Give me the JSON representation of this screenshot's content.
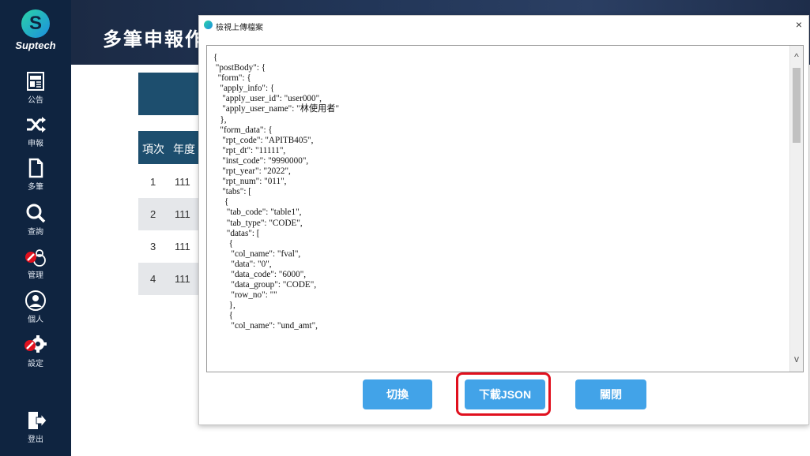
{
  "sidebar": {
    "brand": "Suptech",
    "items": [
      {
        "label": "公告",
        "icon": "announcement-icon"
      },
      {
        "label": "申報",
        "icon": "shuffle-icon"
      },
      {
        "label": "多筆",
        "icon": "document-icon"
      },
      {
        "label": "查詢",
        "icon": "search-icon"
      },
      {
        "label": "管理",
        "icon": "users-admin-icon"
      },
      {
        "label": "個人",
        "icon": "user-icon"
      },
      {
        "label": "設定",
        "icon": "gear-icon"
      },
      {
        "label": "登出",
        "icon": "logout-icon"
      }
    ]
  },
  "header": {
    "title": "多筆申報作"
  },
  "table": {
    "headers": [
      "項次",
      "年度"
    ],
    "rows": [
      [
        "1",
        "111"
      ],
      [
        "2",
        "111"
      ],
      [
        "3",
        "111"
      ],
      [
        "4",
        "111"
      ]
    ]
  },
  "modal": {
    "title": "檢視上傳檔案",
    "close": "×",
    "json_text": "{\n \"postBody\": {\n  \"form\": {\n   \"apply_info\": {\n    \"apply_user_id\": \"user000\",\n    \"apply_user_name\": \"林使用者\"\n   },\n   \"form_data\": {\n    \"rpt_code\": \"APITB405\",\n    \"rpt_dt\": \"11111\",\n    \"inst_code\": \"9990000\",\n    \"rpt_year\": \"2022\",\n    \"rpt_num\": \"011\",\n    \"tabs\": [\n     {\n      \"tab_code\": \"table1\",\n      \"tab_type\": \"CODE\",\n      \"datas\": [\n       {\n        \"col_name\": \"fval\",\n        \"data\": \"0\",\n        \"data_code\": \"6000\",\n        \"data_group\": \"CODE\",\n        \"row_no\": \"\"\n       },\n       {\n        \"col_name\": \"und_amt\",",
    "buttons": {
      "switch": "切換",
      "download": "下載JSON",
      "close": "關閉"
    },
    "scroll_up": "^",
    "scroll_down": "v"
  },
  "colors": {
    "sidebar": "#0f2440",
    "button": "#42a3e8",
    "highlight": "#e0101e"
  }
}
